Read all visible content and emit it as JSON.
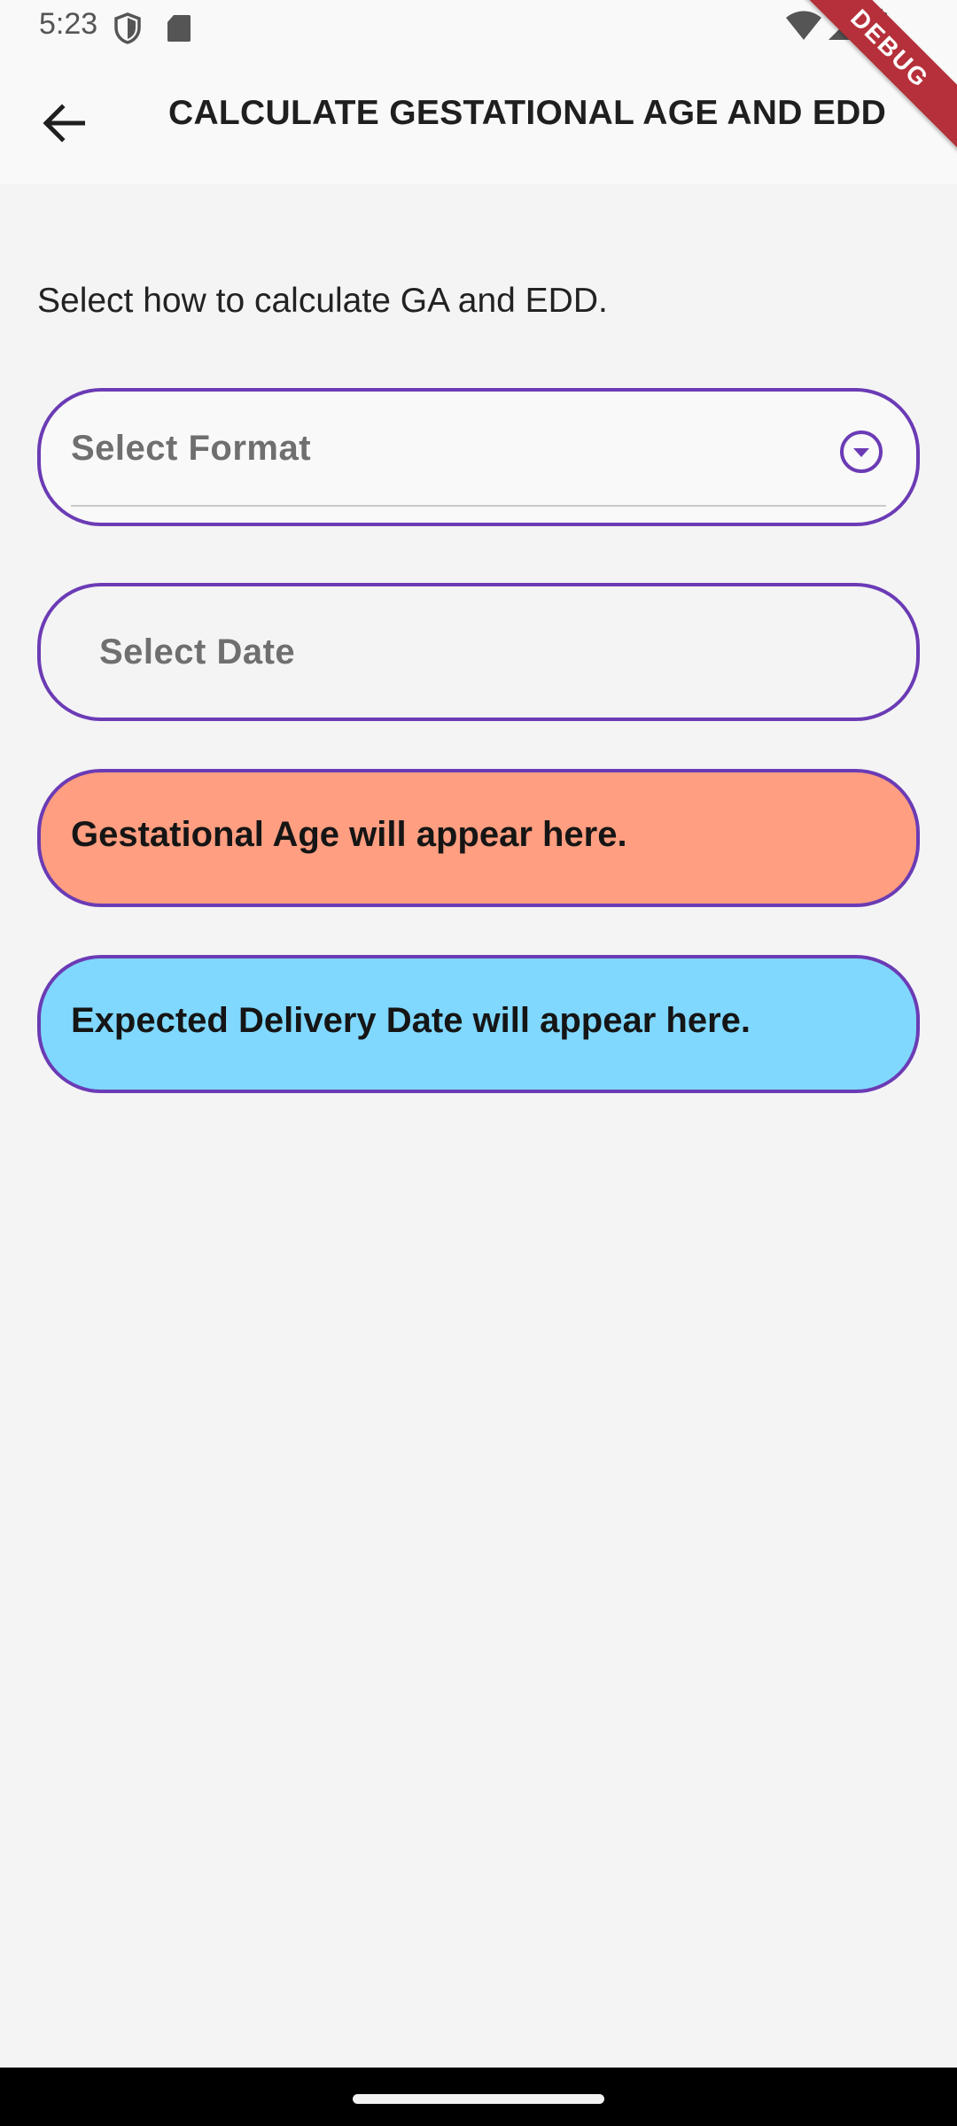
{
  "status_bar": {
    "time": "5:23",
    "icons": [
      "shield-icon",
      "sd-card-icon",
      "wifi-icon",
      "cell-signal-icon",
      "battery-icon"
    ]
  },
  "debug_banner": "DEBUG",
  "app_bar": {
    "back_icon": "arrow-back-icon",
    "title": "CALCULATE GESTATIONAL AGE AND EDD"
  },
  "form": {
    "instruction": "Select how to calculate GA and EDD.",
    "format_placeholder": "Select Format",
    "format_dropdown_icon": "chevron-down-circle-icon",
    "date_placeholder": "Select Date"
  },
  "results": {
    "gestational_age": "Gestational Age will appear here.",
    "expected_delivery_date": "Expected Delivery Date will appear here."
  },
  "colors": {
    "accent_border": "#6b3bb5",
    "ga_background": "#ff9e80",
    "edd_background": "#80d8ff",
    "debug_ribbon": "#b5303a"
  }
}
